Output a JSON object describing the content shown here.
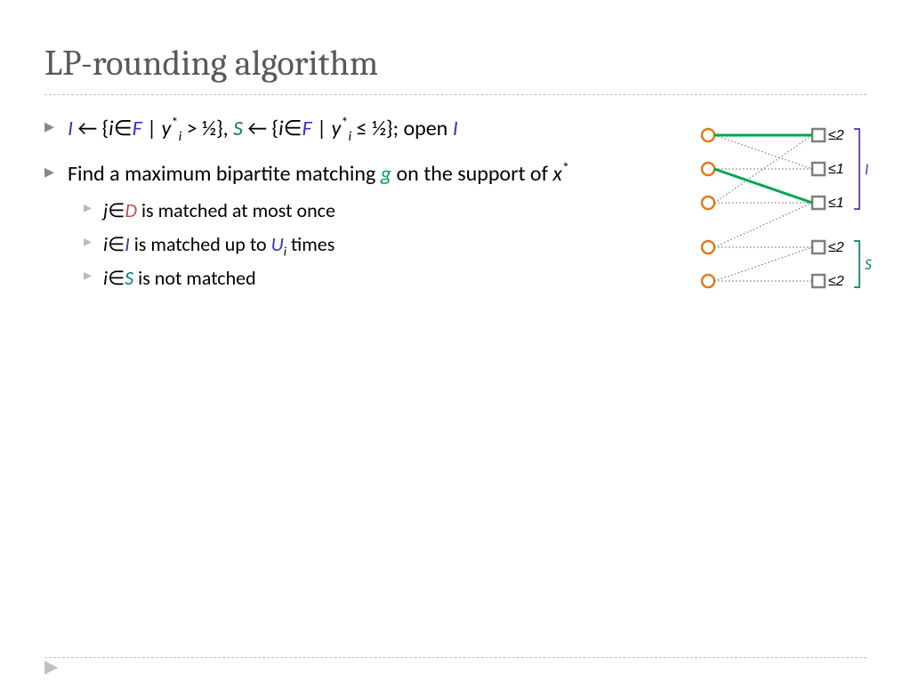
{
  "title": "LP-rounding algorithm",
  "bullet1": {
    "I": "I",
    "arrow1": " ← {",
    "i1": "i",
    "in1": "∈",
    "F1": "F",
    "bar1": " | ",
    "y1": "y",
    "star1": "*",
    "isub1": "i",
    "gt": " > ½}, ",
    "S": "S",
    "arrow2": " ← {",
    "i2": "i",
    "in2": "∈",
    "F2": "F",
    "bar2": " | ",
    "y2": "y",
    "star2": "*",
    "isub2": "i",
    "le": " ≤ ½}; open ",
    "Iend": "I"
  },
  "bullet2": {
    "pre": "Find a maximum bipartite matching ",
    "g": "g",
    "mid": " on the support of ",
    "x": "x",
    "star": "*"
  },
  "sub1": {
    "j": "j",
    "in": "∈",
    "D": "D",
    "rest": " is matched at most once"
  },
  "sub2": {
    "i": "i",
    "in": "∈",
    "I": "I",
    "mid": " is matched up to ",
    "U": "U",
    "isub": "i",
    "rest": " times"
  },
  "sub3": {
    "i": "i",
    "in": "∈",
    "S": "S",
    "rest": " is not matched"
  },
  "fig": {
    "leq2a": "≤2",
    "leq1a": "≤1",
    "leq1b": "≤1",
    "leq2b": "≤2",
    "leq2c": "≤2",
    "labI": "I",
    "labS": "S"
  }
}
